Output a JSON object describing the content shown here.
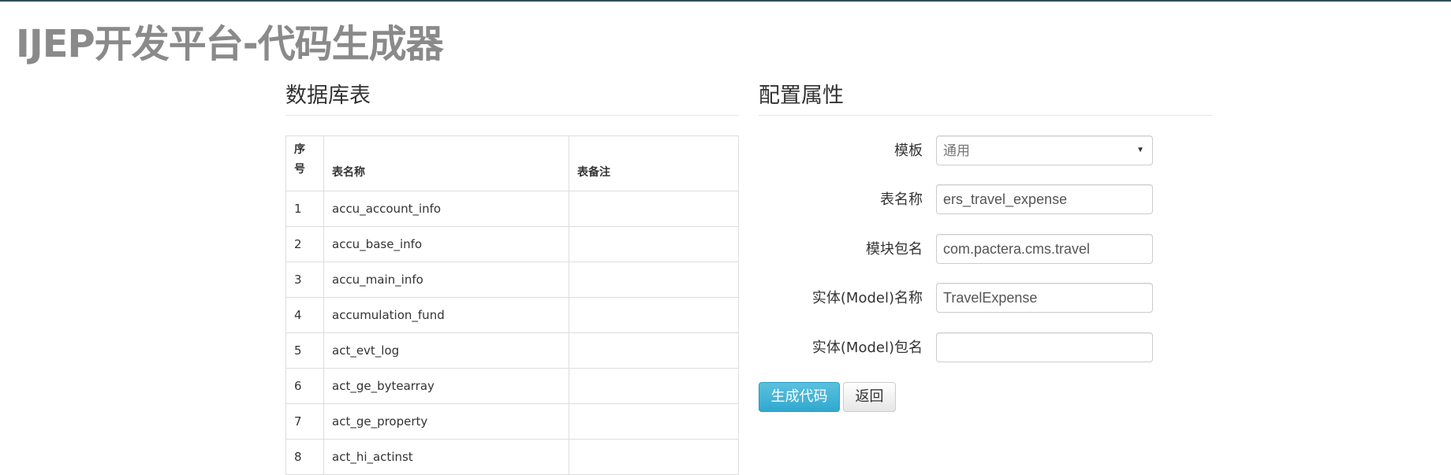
{
  "app_title": "IJEP开发平台-代码生成器",
  "tables_section": {
    "heading": "数据库表",
    "columns": {
      "seq_line1": "序",
      "seq_line2": "号",
      "name": "表名称",
      "remark": "表备注"
    },
    "rows": [
      {
        "seq": "1",
        "name": "accu_account_info",
        "remark": ""
      },
      {
        "seq": "2",
        "name": "accu_base_info",
        "remark": ""
      },
      {
        "seq": "3",
        "name": "accu_main_info",
        "remark": ""
      },
      {
        "seq": "4",
        "name": "accumulation_fund",
        "remark": ""
      },
      {
        "seq": "5",
        "name": "act_evt_log",
        "remark": ""
      },
      {
        "seq": "6",
        "name": "act_ge_bytearray",
        "remark": ""
      },
      {
        "seq": "7",
        "name": "act_ge_property",
        "remark": ""
      },
      {
        "seq": "8",
        "name": "act_hi_actinst",
        "remark": ""
      }
    ]
  },
  "config_section": {
    "heading": "配置属性",
    "template": {
      "label": "模板",
      "selected": "通用"
    },
    "table_name": {
      "label": "表名称",
      "value": "ers_travel_expense"
    },
    "module_package": {
      "label": "模块包名",
      "value": "com.pactera.cms.travel"
    },
    "model_name": {
      "label": "实体(Model)名称",
      "value": "TravelExpense"
    },
    "model_package": {
      "label": "实体(Model)包名",
      "value": ""
    },
    "generate_button": "生成代码",
    "back_button": "返回"
  }
}
